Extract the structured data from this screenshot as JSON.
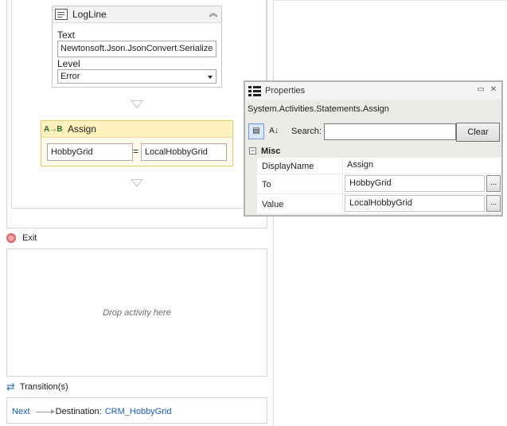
{
  "logline": {
    "title": "LogLine",
    "text_label": "Text",
    "text_value": "Newtonsoft.Json.JsonConvert.Serialize",
    "level_label": "Level",
    "level_value": "Error"
  },
  "assign": {
    "title": "Assign",
    "icon_text": "A→B",
    "to": "HobbyGrid",
    "equals": "=",
    "value": "LocalHobbyGrid"
  },
  "exit": {
    "label": "Exit",
    "drop_hint": "Drop activity here"
  },
  "transitions": {
    "label": "Transition(s)",
    "next": "Next",
    "destination_label": "Destination:",
    "destination": "CRM_HobbyGrid"
  },
  "properties": {
    "title": "Properties",
    "type_name": "System.Activities.Statements.Assign",
    "search_label": "Search:",
    "search_value": "",
    "clear_label": "Clear",
    "category": "Misc",
    "rows": [
      {
        "name": "DisplayName",
        "value": "Assign"
      },
      {
        "name": "To",
        "value": "HobbyGrid"
      },
      {
        "name": "Value",
        "value": "LocalHobbyGrid"
      }
    ],
    "ellipsis": "..."
  },
  "icons": {
    "logline": "document-lines-icon",
    "collapse": "double-chevron-up-icon",
    "properties": "property-grid-icon",
    "categorized": "categorized-icon",
    "alphabetical": "sort-az-icon",
    "exit": "exit-icon",
    "transition": "transition-arrows-icon"
  }
}
